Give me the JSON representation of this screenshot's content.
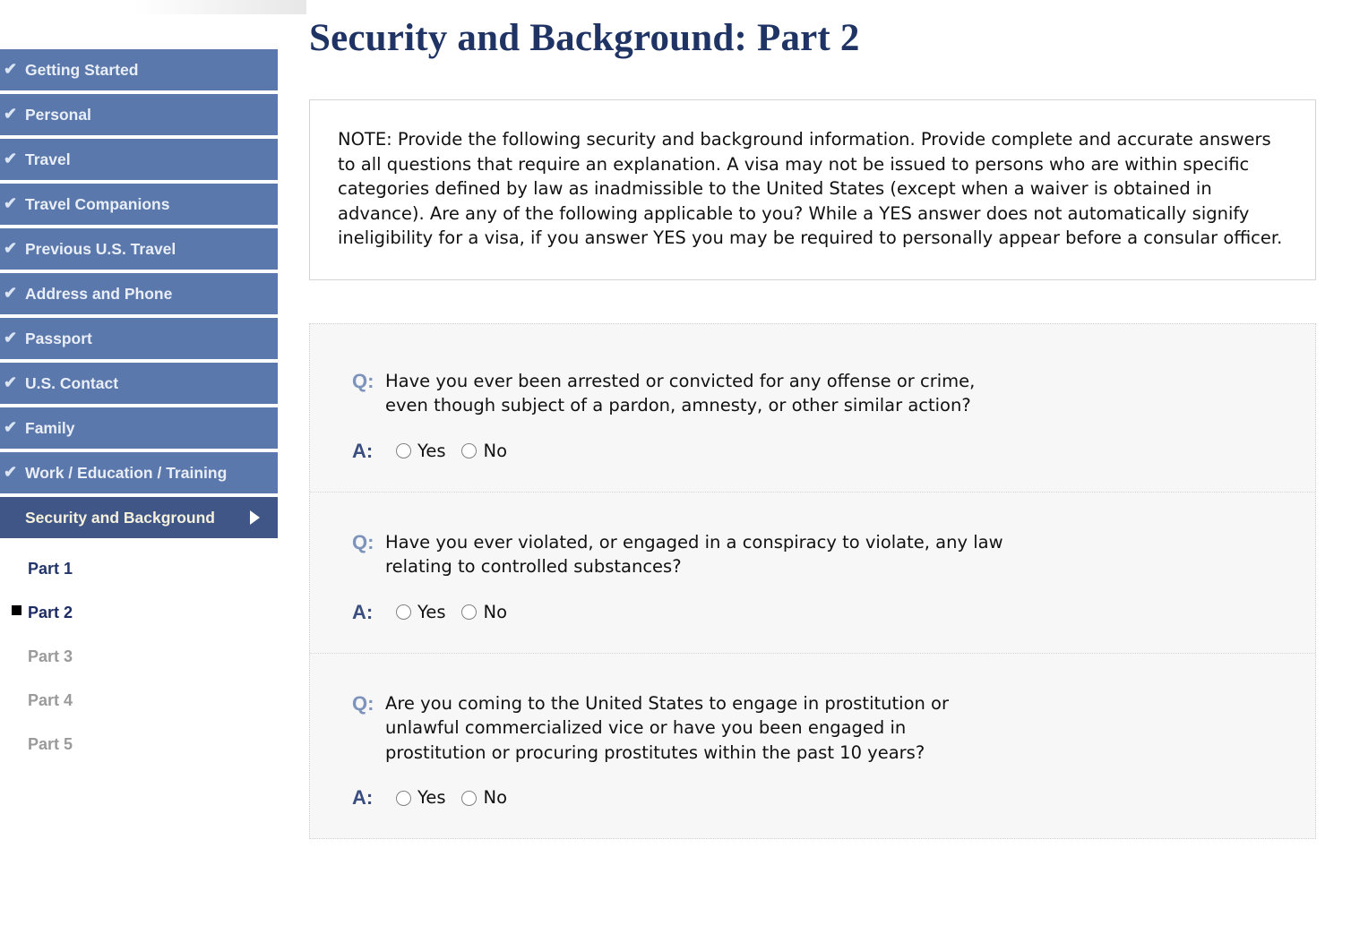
{
  "header": {
    "page_title": "Security and Background: Part 2"
  },
  "sidebar": {
    "items": [
      {
        "label": "Getting Started",
        "icon": "check-icon",
        "completed": true
      },
      {
        "label": "Personal",
        "icon": "check-icon",
        "completed": true
      },
      {
        "label": "Travel",
        "icon": "check-icon",
        "completed": true
      },
      {
        "label": "Travel Companions",
        "icon": "check-icon",
        "completed": true
      },
      {
        "label": "Previous U.S. Travel",
        "icon": "check-icon",
        "completed": true
      },
      {
        "label": "Address and Phone",
        "icon": "check-icon",
        "completed": true
      },
      {
        "label": "Passport",
        "icon": "check-icon",
        "completed": true
      },
      {
        "label": "U.S. Contact",
        "icon": "check-icon",
        "completed": true
      },
      {
        "label": "Family",
        "icon": "check-icon",
        "completed": true
      },
      {
        "label": "Work / Education / Training",
        "icon": "check-icon",
        "completed": true
      },
      {
        "label": "Security and Background",
        "icon": "triangle-right-icon",
        "completed": false,
        "active": true
      }
    ],
    "check_glyph": "✔",
    "sub_items": [
      {
        "label": "Part 1",
        "state": "visited"
      },
      {
        "label": "Part 2",
        "state": "current"
      },
      {
        "label": "Part 3",
        "state": "pending"
      },
      {
        "label": "Part 4",
        "state": "pending"
      },
      {
        "label": "Part 5",
        "state": "pending"
      }
    ]
  },
  "note": {
    "text": "NOTE: Provide the following security and background information. Provide complete and accurate answers to all questions that require an explanation. A visa may not be issued to persons who are within specific categories defined by law as inadmissible to the United States (except when a waiver is obtained in advance). Are any of the following applicable to you? While a YES answer does not automatically signify ineligibility for a visa, if you answer YES you may be required to personally appear before a consular officer."
  },
  "questions": {
    "q_label": "Q:",
    "a_label": "A:",
    "yes_label": "Yes",
    "no_label": "No",
    "items": [
      {
        "question": "Have you ever been arrested or convicted for any offense or crime, even though subject of a pardon, amnesty, or other similar action?",
        "answer": ""
      },
      {
        "question": "Have you ever violated, or engaged in a conspiracy to violate, any law relating to controlled substances?",
        "answer": ""
      },
      {
        "question": "Are you coming to the United States to engage in prostitution or unlawful commercialized vice or have you been engaged in prostitution or procuring prostitutes within the past 10 years?",
        "answer": ""
      }
    ]
  },
  "colors": {
    "nav_blue": "#5a78ab",
    "nav_active_blue": "#3f5686",
    "title_navy": "#1f3465",
    "q_label_blue": "#7d93bb",
    "a_label_blue": "#3a4f80",
    "panel_gray": "#f7f7f7"
  }
}
